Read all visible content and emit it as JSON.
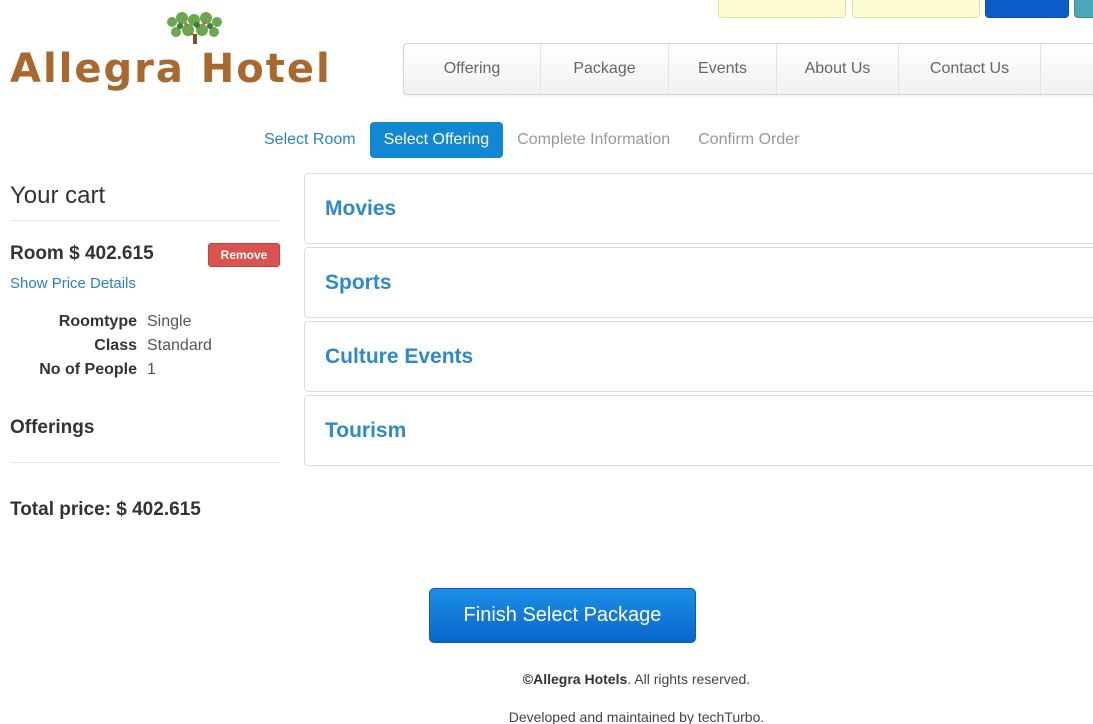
{
  "header": {
    "logo_text": "Allegra Hotel",
    "nav": [
      "Offering",
      "Package",
      "Events",
      "About Us",
      "Contact Us"
    ]
  },
  "steps": {
    "select_room": "Select Room",
    "select_offering": "Select Offering",
    "complete_information": "Complete Information",
    "confirm_order": "Confirm Order"
  },
  "cart": {
    "title": "Your cart",
    "room_line": "Room $ 402.615",
    "remove_label": "Remove",
    "price_details_link": "Show Price Details",
    "details": [
      {
        "label": "Roomtype",
        "value": "Single"
      },
      {
        "label": "Class",
        "value": "Standard"
      },
      {
        "label": "No of People",
        "value": "1"
      }
    ],
    "offerings_heading": "Offerings",
    "total_price": "Total price: $ 402.615"
  },
  "accordion": [
    "Movies",
    "Sports",
    "Culture Events",
    "Tourism"
  ],
  "finish_button": "Finish Select Package",
  "footer": {
    "brand": "©Allegra Hotels",
    "rights": ". All rights reserved.",
    "developed": "Developed and maintained by techTurbo."
  },
  "colors": {
    "brand": "#a9692e",
    "accent": "#1188d1",
    "link": "#2a82c4",
    "danger": "#d9534f"
  }
}
